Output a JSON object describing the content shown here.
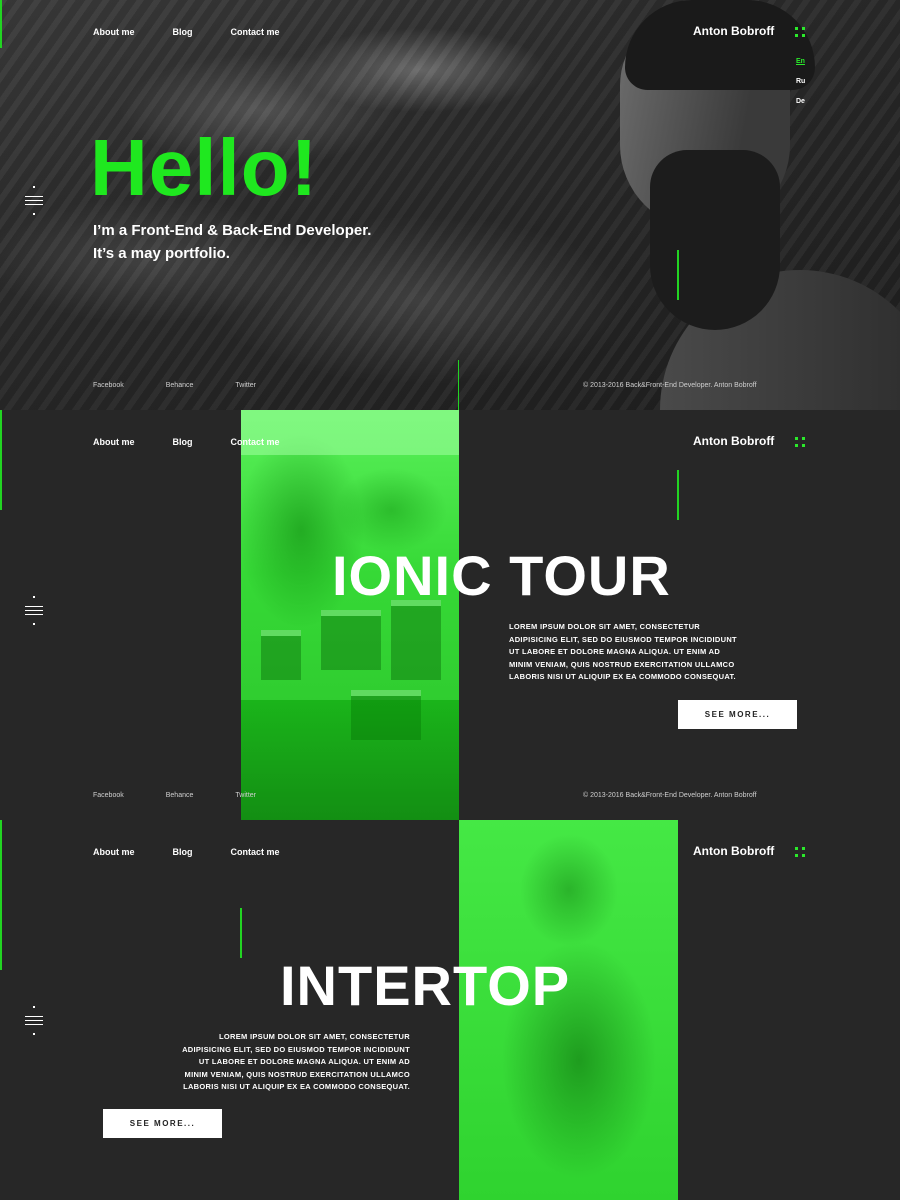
{
  "nav": {
    "items": [
      {
        "label": "About me"
      },
      {
        "label": "Blog"
      },
      {
        "label": "Contact me"
      }
    ]
  },
  "brand": {
    "name": "Anton Bobroff"
  },
  "languages": {
    "items": [
      "En",
      "Ru",
      "De"
    ],
    "active": "En"
  },
  "hero": {
    "headline": "Hello!",
    "subtitle_line1": "I’m a Front-End & Back-End Developer.",
    "subtitle_line2": "It’s a may portfolio."
  },
  "footer": {
    "links": [
      "Facebook",
      "Behance",
      "Twitter"
    ],
    "copyright": "© 2013-2016 Back&Front-End Developer. Anton Bobroff"
  },
  "projects": [
    {
      "title": "IONIC TOUR",
      "description_lines": [
        "LOREM IPSUM DOLOR SIT AMET, CONSECTETUR",
        "ADIPISICING ELIT, SED DO EIUSMOD TEMPOR INCIDIDUNT",
        "UT LABORE ET DOLORE MAGNA ALIQUA. UT ENIM AD",
        "MINIM VENIAM, QUIS NOSTRUD EXERCITATION ULLAMCO",
        "LABORIS NISI UT ALIQUIP EX EA COMMODO CONSEQUAT."
      ],
      "button": "SEE MORE..."
    },
    {
      "title": "INTERTOP",
      "description_lines": [
        "LOREM IPSUM DOLOR SIT AMET, CONSECTETUR",
        "ADIPISICING ELIT, SED DO EIUSMOD TEMPOR INCIDIDUNT",
        "UT LABORE ET DOLORE MAGNA ALIQUA. UT ENIM AD",
        "MINIM VENIAM, QUIS NOSTRUD EXERCITATION ULLAMCO",
        "LABORIS NISI UT ALIQUIP EX EA COMMODO CONSEQUAT."
      ],
      "button": "SEE MORE..."
    }
  ],
  "colors": {
    "accent": "#1fe81f",
    "background": "#272727",
    "text": "#ffffff"
  },
  "icons": [
    "menu-icon",
    "dots-grid-icon"
  ]
}
